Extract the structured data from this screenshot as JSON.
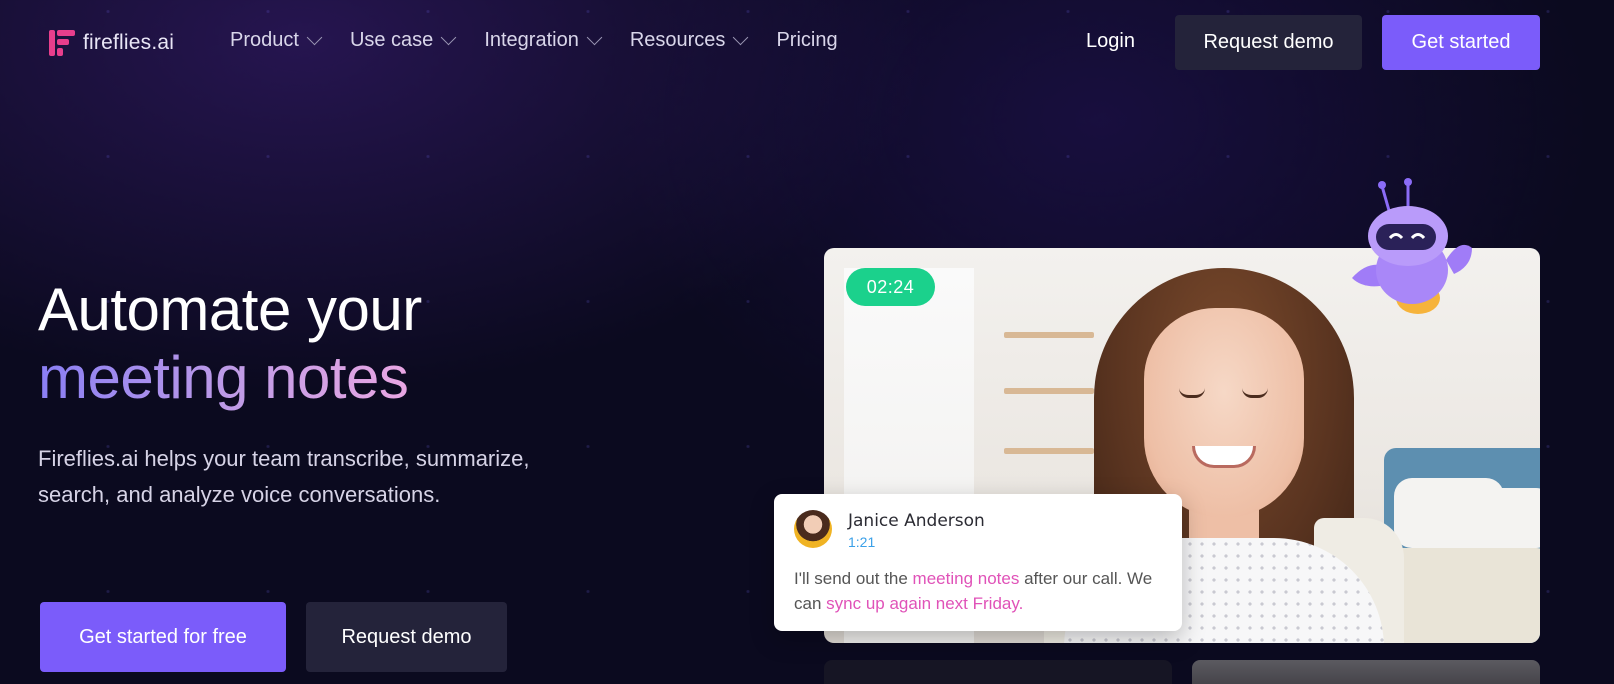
{
  "nav": {
    "logo_text": "fireflies.ai",
    "items": [
      {
        "label": "Product",
        "has_dropdown": true
      },
      {
        "label": "Use case",
        "has_dropdown": true
      },
      {
        "label": "Integration",
        "has_dropdown": true
      },
      {
        "label": "Resources",
        "has_dropdown": true
      },
      {
        "label": "Pricing",
        "has_dropdown": false
      }
    ],
    "login_label": "Login",
    "request_demo_label": "Request demo",
    "get_started_label": "Get started"
  },
  "hero": {
    "title_line1": "Automate your",
    "title_line2": "meeting notes",
    "subtitle": "Fireflies.ai helps your team transcribe, summarize, search, and analyze voice conversations.",
    "cta_primary": "Get started for free",
    "cta_secondary": "Request demo"
  },
  "video": {
    "timer": "02:24"
  },
  "transcript_card": {
    "speaker": "Janice Anderson",
    "timestamp": "1:21",
    "text_part1": "I'll send out the ",
    "highlight1": "meeting notes",
    "text_part2": " after our call. We can ",
    "highlight2": "sync up again next Friday."
  },
  "colors": {
    "background": "#0b0a1f",
    "accent_purple": "#7b5cfa",
    "timer_green": "#1bd18c",
    "highlight_pink": "#e052b8",
    "logo_pink": "#e83e8c"
  },
  "icons": [
    "fireflies-logo-icon",
    "chevron-down-icon",
    "robot-mascot-icon",
    "speaker-avatar"
  ]
}
